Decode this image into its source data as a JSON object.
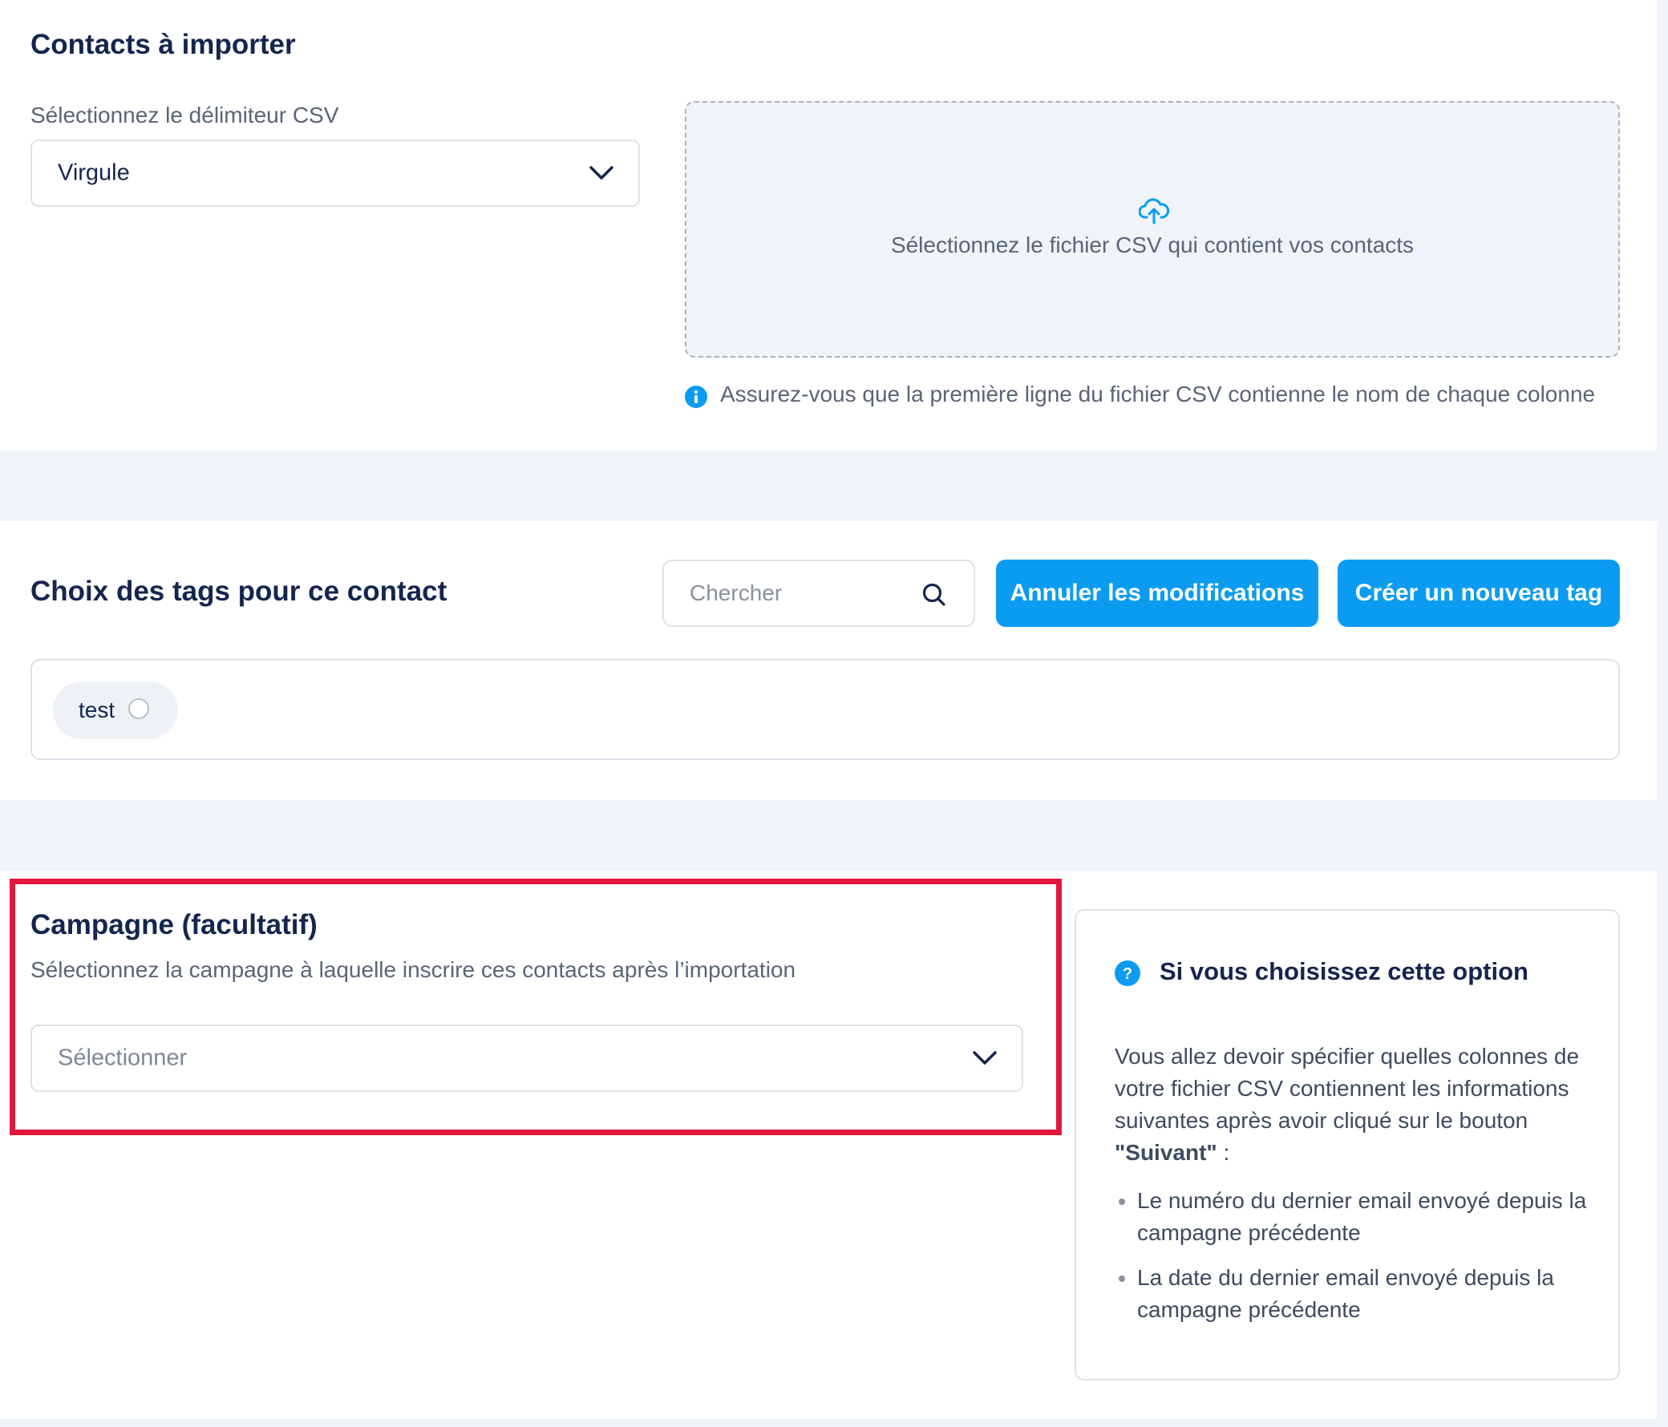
{
  "import_section": {
    "title": "Contacts à importer",
    "delimiter_label": "Sélectionnez le délimiteur CSV",
    "delimiter_value": "Virgule",
    "dropzone_text": "Sélectionnez le fichier CSV qui contient vos contacts",
    "info_note": "Assurez-vous que la première ligne du fichier CSV contienne le nom de chaque colonne",
    "icons": {
      "upload": "cloud-upload-icon",
      "info": "info-icon",
      "dropdown": "chevron-down-icon"
    }
  },
  "tags_section": {
    "title": "Choix des tags pour ce contact",
    "search_placeholder": "Chercher",
    "cancel_button": "Annuler les modifications",
    "create_button": "Créer un nouveau tag",
    "tags": [
      {
        "label": "test",
        "selected": false
      }
    ],
    "icons": {
      "search": "search-icon"
    }
  },
  "campaign_section": {
    "title": "Campagne (facultatif)",
    "subtitle": "Sélectionnez la campagne à laquelle inscrire ces contacts après l’importation",
    "select_placeholder": "Sélectionner",
    "highlight_color": "#e0173b"
  },
  "help_panel": {
    "title": "Si vous choisissez cette option",
    "intro": "Vous allez devoir spécifier quelles colonnes de votre fichier CSV contiennent les informations suivantes après avoir cliqué sur le bouton",
    "intro_strong": "\"Suivant\"",
    "intro_end": " :",
    "bullets": [
      "Le numéro du dernier email envoyé depuis la campagne précédente",
      "La date du dernier email envoyé depuis la campagne précédente"
    ],
    "icons": {
      "help": "question-circle-icon"
    }
  },
  "colors": {
    "primary": "#0b9cf2",
    "heading": "#14254e",
    "background": "#f0f3f8",
    "highlight": "#e0173b"
  }
}
